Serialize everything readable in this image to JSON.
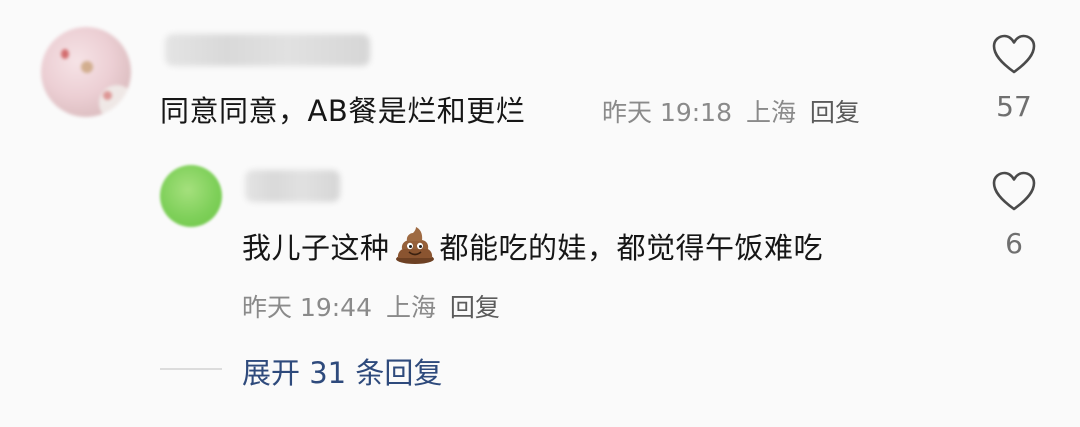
{
  "comment": {
    "text": "同意同意，AB餐是烂和更烂",
    "time": "昨天 19:18",
    "location": "上海",
    "reply_label": "回复",
    "likes": "57"
  },
  "reply": {
    "text_before": "我儿子这种",
    "emoji_icon": "poop-emoji",
    "text_after": "都能吃的娃，都觉得午饭难吃",
    "time": "昨天 19:44",
    "location": "上海",
    "reply_label": "回复",
    "likes": "6"
  },
  "expand": {
    "label": "展开 31 条回复"
  }
}
